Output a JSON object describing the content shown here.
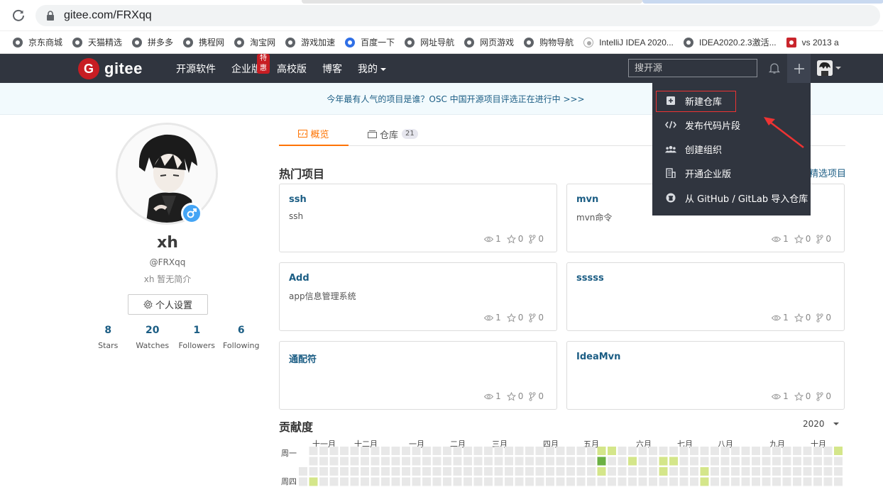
{
  "browser": {
    "url": "gitee.com/FRXqq"
  },
  "bookmarks": [
    {
      "label": "京东商城",
      "icon": "globe-icon"
    },
    {
      "label": "天猫精选",
      "icon": "globe-icon"
    },
    {
      "label": "拼多多",
      "icon": "globe-icon"
    },
    {
      "label": "携程网",
      "icon": "globe-icon"
    },
    {
      "label": "淘宝网",
      "icon": "globe-icon"
    },
    {
      "label": "游戏加速",
      "icon": "globe-icon"
    },
    {
      "label": "百度一下",
      "icon": "baidu-paw-icon"
    },
    {
      "label": "网址导航",
      "icon": "globe-icon"
    },
    {
      "label": "网页游戏",
      "icon": "globe-icon"
    },
    {
      "label": "购物导航",
      "icon": "globe-icon"
    },
    {
      "label": "IntelliJ IDEA 2020...",
      "icon": "idea-icon"
    },
    {
      "label": "IDEA2020.2.3激活...",
      "icon": "globe-icon"
    },
    {
      "label": "vs 2013 a",
      "icon": "csdn-icon"
    }
  ],
  "navbar": {
    "logo_letter": "G",
    "logo_text": "gitee",
    "items": [
      {
        "label": "开源软件"
      },
      {
        "label": "企业版",
        "badge": "特惠"
      },
      {
        "label": "高校版"
      },
      {
        "label": "博客"
      },
      {
        "label": "我的",
        "dropdown": true
      }
    ],
    "search_placeholder": "搜开源"
  },
  "banner": {
    "text": "今年最有人气的项目是谁？OSC 中国开源项目评选正在进行中 >>>"
  },
  "profile": {
    "name": "xh",
    "handle": "@FRXqq",
    "bio": "xh 暂无简介",
    "settings_label": "个人设置",
    "stats": [
      {
        "value": "8",
        "label": "Stars"
      },
      {
        "value": "20",
        "label": "Watches"
      },
      {
        "value": "1",
        "label": "Followers"
      },
      {
        "value": "6",
        "label": "Following"
      }
    ]
  },
  "tabs": {
    "overview": "概览",
    "repos": "仓库",
    "repo_count": "21"
  },
  "hot_projects": {
    "title": "热门项目",
    "featured_link": "精选项目",
    "cards": [
      {
        "name": "ssh",
        "desc": "ssh",
        "watch": "1",
        "star": "0",
        "fork": "0"
      },
      {
        "name": "mvn",
        "desc": "mvn命令",
        "watch": "1",
        "star": "0",
        "fork": "0"
      },
      {
        "name": "Add",
        "desc": "app信息管理系统",
        "watch": "1",
        "star": "0",
        "fork": "0"
      },
      {
        "name": "sssss",
        "desc": "",
        "watch": "1",
        "star": "0",
        "fork": "0"
      },
      {
        "name": "通配符",
        "desc": "",
        "watch": "1",
        "star": "0",
        "fork": "0"
      },
      {
        "name": "IdeaMvn",
        "desc": "",
        "watch": "1",
        "star": "0",
        "fork": "0"
      }
    ]
  },
  "contributions": {
    "title": "贡献度",
    "year": "2020",
    "months": [
      "十一月",
      "十二月",
      "一月",
      "二月",
      "三月",
      "四月",
      "五月",
      "六月",
      "七月",
      "八月",
      "九月",
      "十月"
    ],
    "day_labels": [
      "周一",
      "周四"
    ],
    "colors": {
      "empty": "#e8e8e8",
      "light": "#d4e68a",
      "medium": "#a4cf5a",
      "dark": "#6bb043"
    }
  },
  "dropdown": {
    "items": [
      {
        "label": "新建仓库",
        "icon": "plus-square-icon"
      },
      {
        "label": "发布代码片段",
        "icon": "code-icon"
      },
      {
        "label": "创建组织",
        "icon": "group-icon"
      },
      {
        "label": "开通企业版",
        "icon": "building-icon"
      },
      {
        "label": "从 GitHub / GitLab 导入仓库",
        "icon": "github-icon"
      }
    ]
  },
  "colors": {
    "navbar_bg": "#30353f",
    "brand_red": "#c71d23",
    "link_blue": "#1b5d84",
    "active_orange": "#fe7300",
    "annotation_red": "#e33333"
  }
}
